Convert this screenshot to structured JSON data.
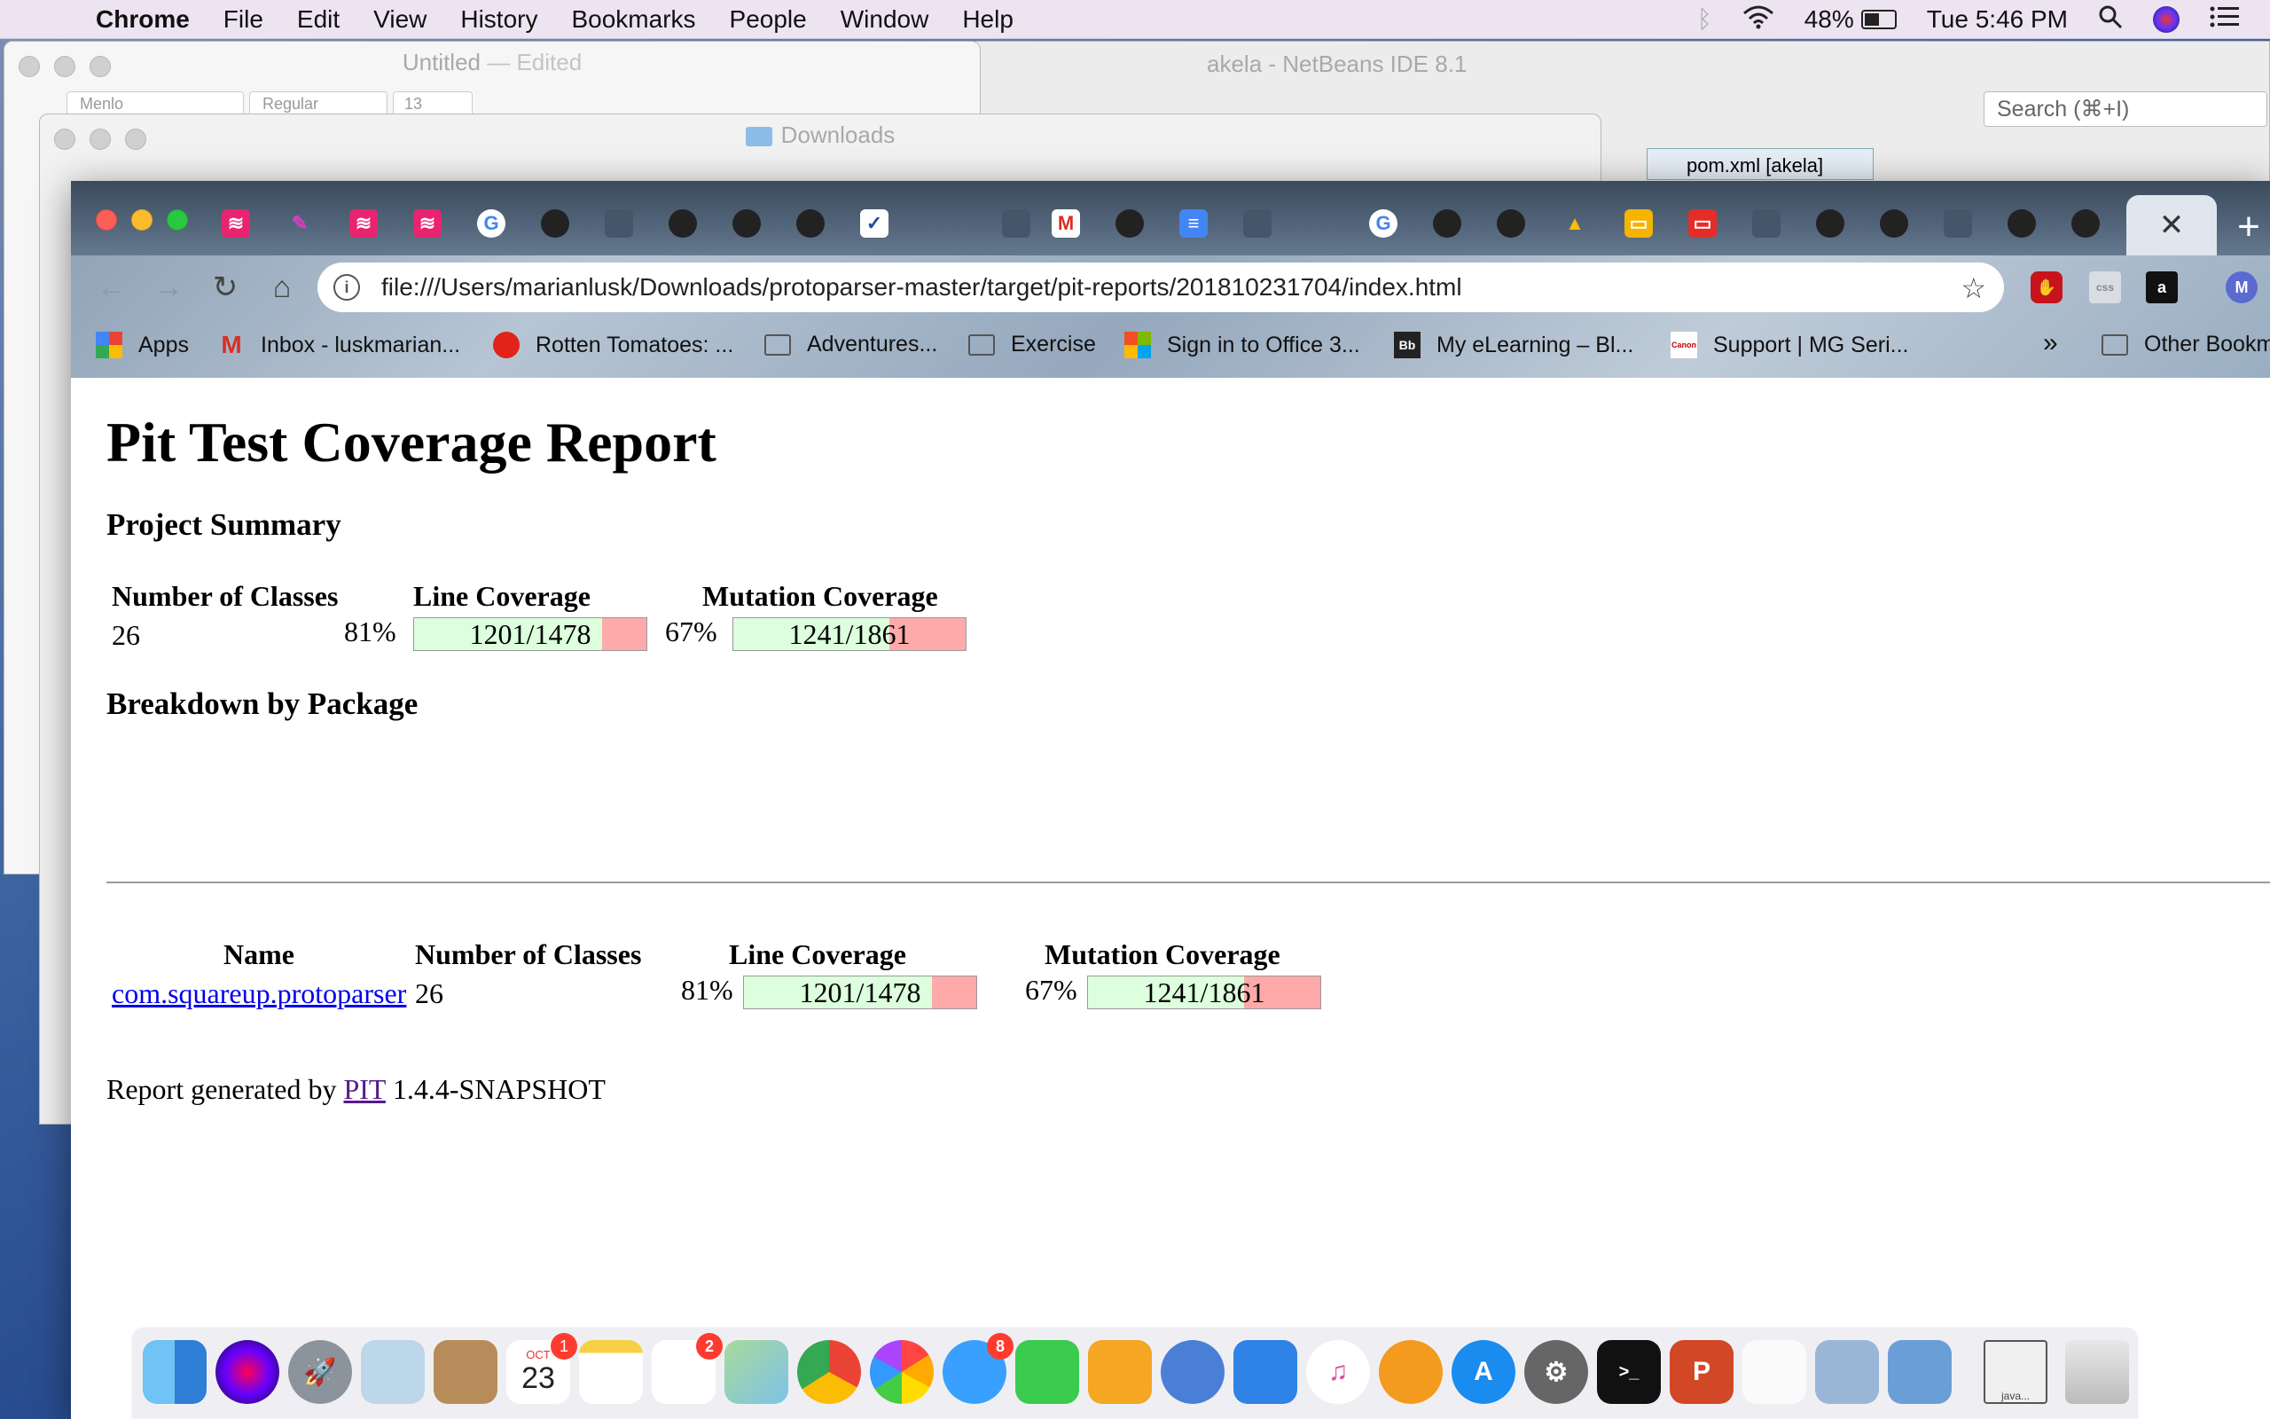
{
  "menubar": {
    "app": "Chrome",
    "menus": [
      "File",
      "Edit",
      "View",
      "History",
      "Bookmarks",
      "People",
      "Window",
      "Help"
    ],
    "battery": "48%",
    "clock": "Tue 5:46 PM"
  },
  "windows": {
    "textedit_title": "Untitled",
    "textedit_edited": "— Edited",
    "textedit_font": "Menlo",
    "textedit_style": "Regular",
    "textedit_size": "13",
    "finder_title": "Downloads",
    "finder_search": "Search",
    "netbeans_title": "akela - NetBeans IDE 8.1",
    "netbeans_search": "Search (⌘+I)",
    "netbeans_tab": "pom.xml [akela]"
  },
  "browser": {
    "url": "file:///Users/marianlusk/Downloads/protoparser-master/target/pit-reports/201810231704/index.html",
    "close_tab": "✕",
    "new_tab": "+",
    "bookmarks": [
      {
        "label": "Apps",
        "icon": "apps-grid-icon"
      },
      {
        "label": "Inbox - luskmarian...",
        "icon": "gmail-icon"
      },
      {
        "label": "Rotten Tomatoes: ...",
        "icon": "tomato-icon"
      },
      {
        "label": "Adventures...",
        "icon": "folder-icon"
      },
      {
        "label": "Exercise",
        "icon": "folder-icon"
      },
      {
        "label": "Sign in to Office 3...",
        "icon": "microsoft-icon"
      },
      {
        "label": "My eLearning – Bl...",
        "icon": "blackboard-icon"
      },
      {
        "label": "Support | MG Seri...",
        "icon": "canon-icon"
      }
    ],
    "bookmarks_more": "»",
    "other_bookmarks": "Other Bookmarks"
  },
  "report": {
    "title": "Pit Test Coverage Report",
    "summary_heading": "Project Summary",
    "headers": {
      "classes": "Number of Classes",
      "line": "Line Coverage",
      "mutation": "Mutation Coverage",
      "name": "Name"
    },
    "summary": {
      "classes": "26",
      "line_pct": "81%",
      "line_label": "1201/1478",
      "line_fill": 0.81,
      "mutation_pct": "67%",
      "mutation_label": "1241/1861",
      "mutation_fill": 0.67
    },
    "breakdown_heading": "Breakdown by Package",
    "packages": [
      {
        "name": "com.squareup.protoparser",
        "classes": "26",
        "line_pct": "81%",
        "line_label": "1201/1478",
        "line_fill": 0.81,
        "mutation_pct": "67%",
        "mutation_label": "1241/1861",
        "mutation_fill": 0.67
      }
    ],
    "footer_prefix": "Report generated by",
    "footer_link": "PIT",
    "footer_version": "1.4.4-SNAPSHOT"
  },
  "dock": {
    "calendar_month": "OCT",
    "calendar_day": "23",
    "badges": {
      "calendar": "1",
      "reminders": "2",
      "messages": "8"
    },
    "java_label": "java..."
  },
  "colors": {
    "coverage_covered": "#ddffdd",
    "coverage_uncovered": "#ffaaaa",
    "link": "#0000ee",
    "visited_link": "#551a8b"
  }
}
